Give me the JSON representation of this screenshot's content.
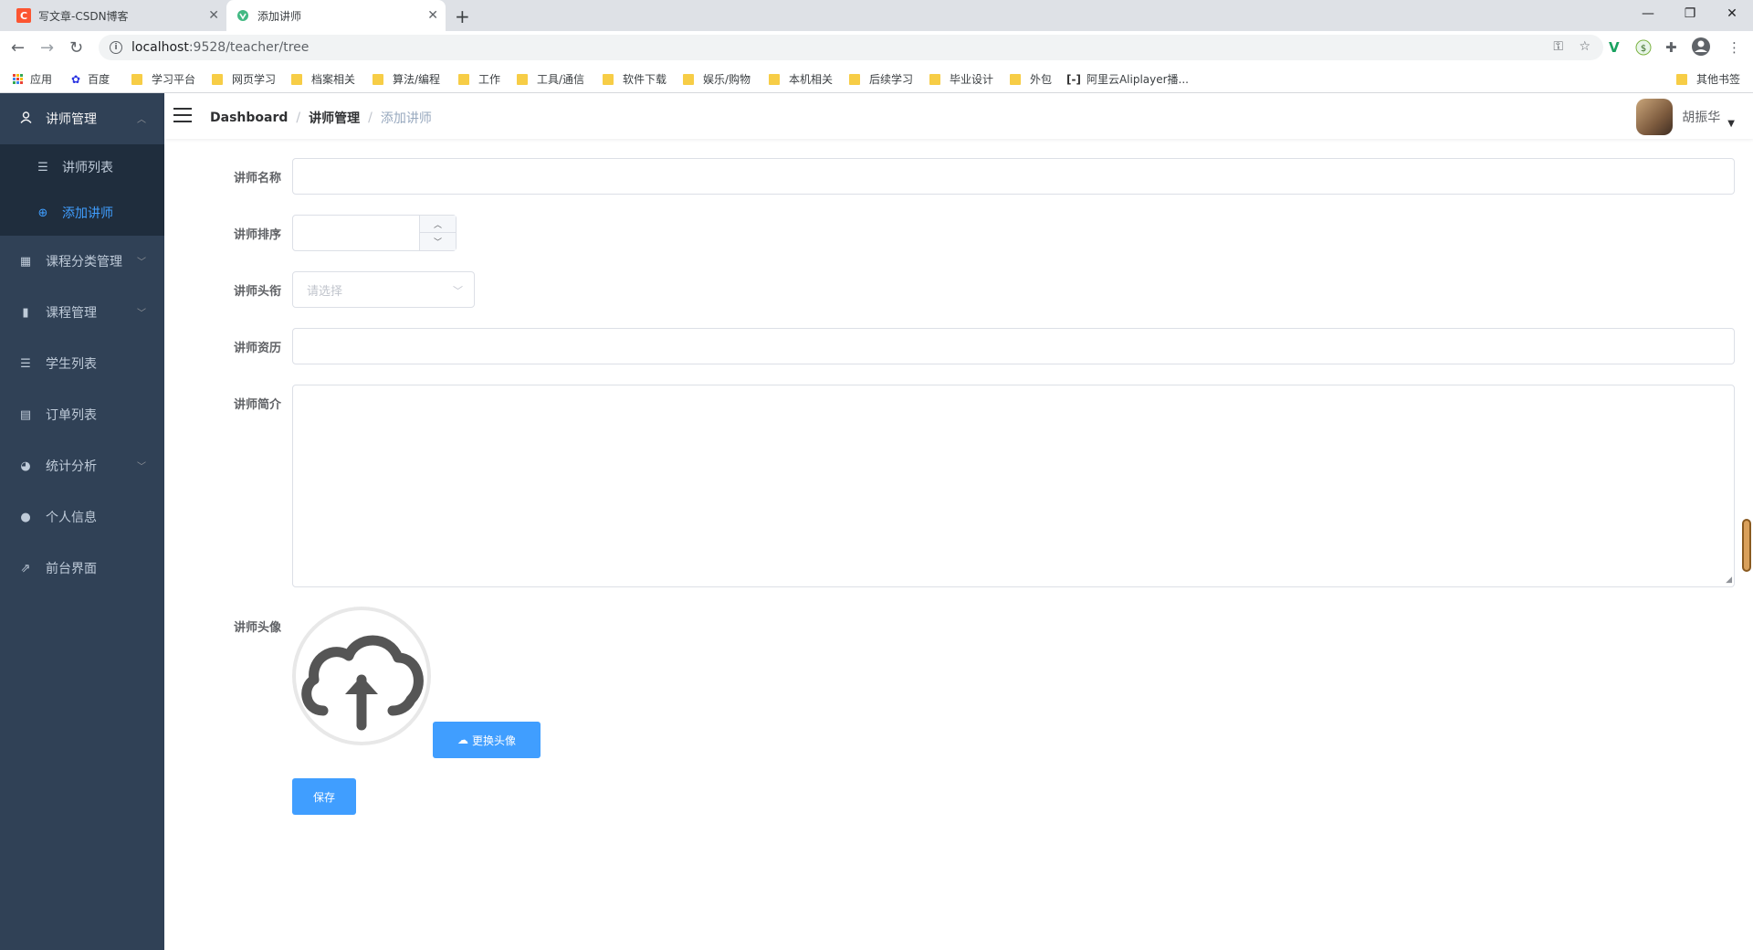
{
  "browser": {
    "tabs": [
      {
        "title": "写文章-CSDN博客",
        "favicon": "C"
      },
      {
        "title": "添加讲师"
      }
    ],
    "url_host": "localhost",
    "url_rest": ":9528/teacher/tree",
    "bookmarks": [
      "应用",
      "百度",
      "学习平台",
      "网页学习",
      "档案相关",
      "算法/编程",
      "工作",
      "工具/通信",
      "软件下载",
      "娱乐/购物",
      "本机相关",
      "后续学习",
      "毕业设计",
      "外包",
      "阿里云Aliplayer播..."
    ],
    "other_bookmarks": "其他书签"
  },
  "sidebar": {
    "open_menu": {
      "label": "讲师管理",
      "icon": "user-icon"
    },
    "sub_items": [
      {
        "label": "讲师列表",
        "icon": "list-icon"
      },
      {
        "label": "添加讲师",
        "icon": "plus-circle-icon"
      }
    ],
    "items": [
      {
        "label": "课程分类管理",
        "icon": "grid-icon",
        "has_arrow": true
      },
      {
        "label": "课程管理",
        "icon": "book-icon",
        "has_arrow": true
      },
      {
        "label": "学生列表",
        "icon": "list-icon",
        "has_arrow": false
      },
      {
        "label": "订单列表",
        "icon": "document-icon",
        "has_arrow": false
      },
      {
        "label": "统计分析",
        "icon": "pie-chart-icon",
        "has_arrow": true
      },
      {
        "label": "个人信息",
        "icon": "person-icon",
        "has_arrow": false
      },
      {
        "label": "前台界面",
        "icon": "external-link-icon",
        "has_arrow": false
      }
    ]
  },
  "navbar": {
    "breadcrumb": [
      "Dashboard",
      "讲师管理",
      "添加讲师"
    ],
    "user_name": "胡振华"
  },
  "form": {
    "name_label": "讲师名称",
    "sort_label": "讲师排序",
    "level_label": "讲师头衔",
    "level_placeholder": "请选择",
    "career_label": "讲师资历",
    "intro_label": "讲师简介",
    "avatar_label": "讲师头像",
    "change_avatar_label": "更换头像",
    "save_label": "保存"
  },
  "colors": {
    "sidebar_bg": "#304156",
    "submenu_bg": "#1f2d3d",
    "accent": "#409eff"
  }
}
